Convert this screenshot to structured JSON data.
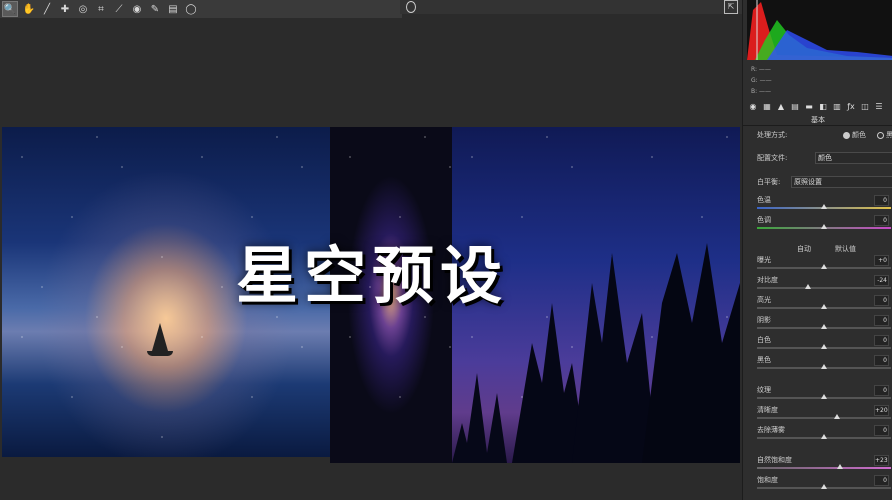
{
  "toolbar": {
    "tools": [
      "zoom-icon",
      "hand-icon",
      "eyedropper-icon",
      "color-sampler-icon",
      "target-adjust-icon",
      "crop-icon",
      "straighten-icon",
      "red-eye-icon",
      "brush-icon",
      "gradient-icon",
      "radial-icon"
    ]
  },
  "canvas": {
    "overlay_title": "星空预设"
  },
  "panel": {
    "rgb": {
      "r": "R:  ——",
      "g": "G:  ——",
      "b": "B:  ——"
    },
    "section_title": "基本",
    "treatment": {
      "label": "处理方式:",
      "option_color": "颜色",
      "option_bw": "黑"
    },
    "profile": {
      "label": "配置文件:",
      "value": "颜色"
    },
    "white_balance": {
      "label": "白平衡:",
      "value": "原照设置"
    },
    "auto_label": "自动",
    "default_label": "默认值",
    "sliders": [
      {
        "label": "色温",
        "value": "0",
        "pos": 0.5,
        "style": "temp"
      },
      {
        "label": "色调",
        "value": "0",
        "pos": 0.5,
        "style": "tint"
      },
      {
        "label": "曝光",
        "value": "+0",
        "pos": 0.5,
        "style": "plain"
      },
      {
        "label": "对比度",
        "value": "-24",
        "pos": 0.38,
        "style": "plain"
      },
      {
        "label": "高光",
        "value": "0",
        "pos": 0.5,
        "style": "plain"
      },
      {
        "label": "阴影",
        "value": "0",
        "pos": 0.5,
        "style": "plain"
      },
      {
        "label": "白色",
        "value": "0",
        "pos": 0.5,
        "style": "plain"
      },
      {
        "label": "黑色",
        "value": "0",
        "pos": 0.5,
        "style": "plain"
      },
      {
        "label": "纹理",
        "value": "0",
        "pos": 0.5,
        "style": "plain"
      },
      {
        "label": "清晰度",
        "value": "+20",
        "pos": 0.6,
        "style": "plain"
      },
      {
        "label": "去除薄雾",
        "value": "0",
        "pos": 0.5,
        "style": "plain"
      },
      {
        "label": "自然饱和度",
        "value": "+23",
        "pos": 0.62,
        "style": "vib"
      },
      {
        "label": "饱和度",
        "value": "0",
        "pos": 0.5,
        "style": "plain"
      }
    ]
  },
  "colors": {
    "bg": "#2b2b2b",
    "panel": "#2e2e2e",
    "histogram_red": "#ff2020",
    "histogram_green": "#20d020",
    "histogram_blue": "#3050ff"
  }
}
